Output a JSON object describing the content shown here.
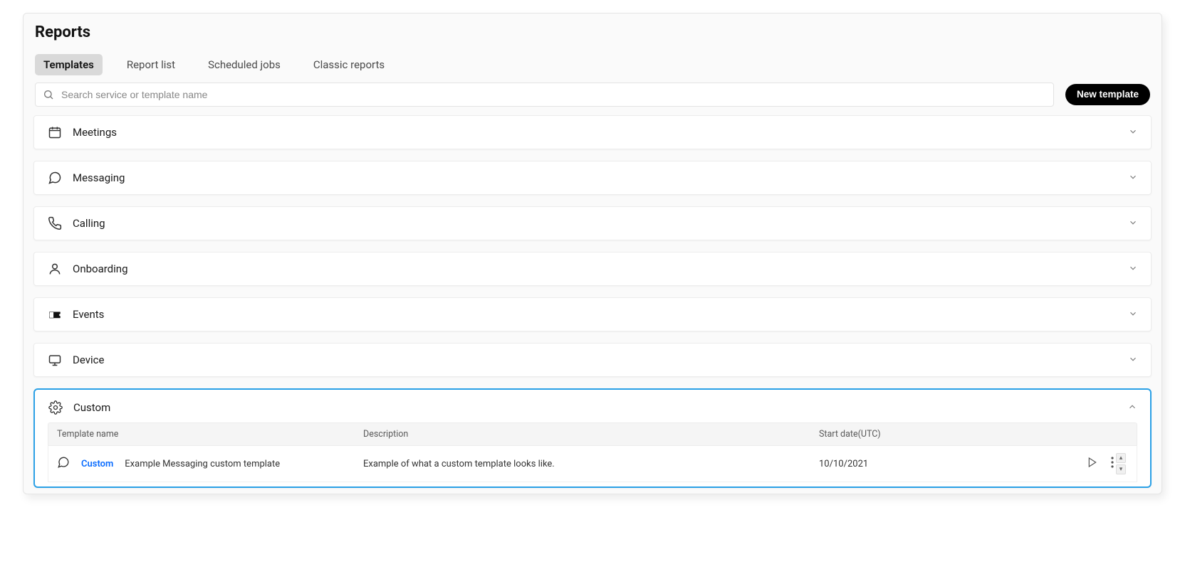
{
  "page": {
    "title": "Reports"
  },
  "tabs": {
    "templates": "Templates",
    "report_list": "Report list",
    "scheduled_jobs": "Scheduled jobs",
    "classic_reports": "Classic reports"
  },
  "search": {
    "placeholder": "Search service or template name"
  },
  "buttons": {
    "new_template": "New template"
  },
  "sections": {
    "meetings": "Meetings",
    "messaging": "Messaging",
    "calling": "Calling",
    "onboarding": "Onboarding",
    "events": "Events",
    "device": "Device",
    "custom": "Custom"
  },
  "custom_table": {
    "headers": {
      "template_name": "Template name",
      "description": "Description",
      "start_date": "Start date(UTC)"
    },
    "rows": [
      {
        "tag": "Custom",
        "name": "Example Messaging custom template",
        "description": "Example of what a custom template looks like.",
        "start_date": "10/10/2021"
      }
    ]
  }
}
